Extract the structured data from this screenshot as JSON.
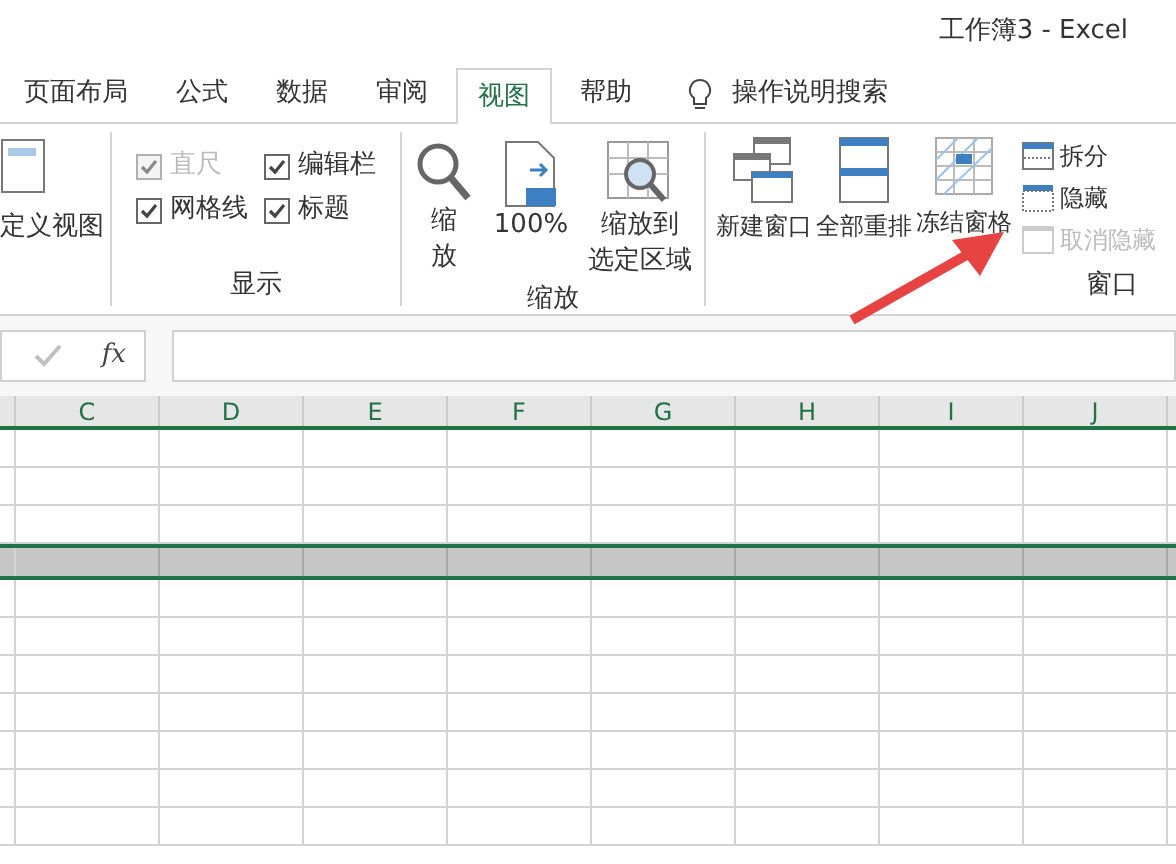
{
  "window": {
    "title": "工作簿3 - Excel"
  },
  "tabs": [
    {
      "label": "页面布局",
      "selected": false
    },
    {
      "label": "公式",
      "selected": false
    },
    {
      "label": "数据",
      "selected": false
    },
    {
      "label": "审阅",
      "selected": false
    },
    {
      "label": "视图",
      "selected": true
    },
    {
      "label": "帮助",
      "selected": false
    }
  ],
  "search": {
    "label": "操作说明搜索"
  },
  "ribbon": {
    "views_group": {
      "button": "定义视图"
    },
    "show_group": {
      "label": "显示",
      "options": [
        {
          "label": "直尺",
          "checked": true,
          "disabled": true
        },
        {
          "label": "编辑栏",
          "checked": true,
          "disabled": false
        },
        {
          "label": "网格线",
          "checked": true,
          "disabled": false
        },
        {
          "label": "标题",
          "checked": true,
          "disabled": false
        }
      ]
    },
    "zoom_group": {
      "label": "缩放",
      "buttons": [
        {
          "kind": "zoom",
          "lines": [
            "缩",
            "放"
          ]
        },
        {
          "kind": "hundred",
          "lines": [
            "100%"
          ]
        },
        {
          "kind": "selection",
          "lines": [
            "缩放到",
            "选定区域"
          ]
        }
      ]
    },
    "window_group": {
      "label": "窗口",
      "buttons": [
        {
          "kind": "new",
          "label": "新建窗口"
        },
        {
          "kind": "arrange",
          "label": "全部重排"
        },
        {
          "kind": "freeze",
          "label": "冻结窗格"
        }
      ],
      "small_buttons": [
        {
          "kind": "split",
          "label": "拆分",
          "disabled": false
        },
        {
          "kind": "hide",
          "label": "隐藏",
          "disabled": false
        },
        {
          "kind": "unhide",
          "label": "取消隐藏",
          "disabled": true
        }
      ]
    }
  },
  "formula_bar": {
    "fx": "fx"
  },
  "columns": [
    "C",
    "D",
    "E",
    "F",
    "G",
    "H",
    "I",
    "J"
  ],
  "rows": [
    {
      "selected": false
    },
    {
      "selected": false
    },
    {
      "selected": false
    },
    {
      "selected": true
    },
    {
      "selected": false
    },
    {
      "selected": false
    },
    {
      "selected": false
    },
    {
      "selected": false
    },
    {
      "selected": false
    },
    {
      "selected": false
    },
    {
      "selected": false
    }
  ]
}
